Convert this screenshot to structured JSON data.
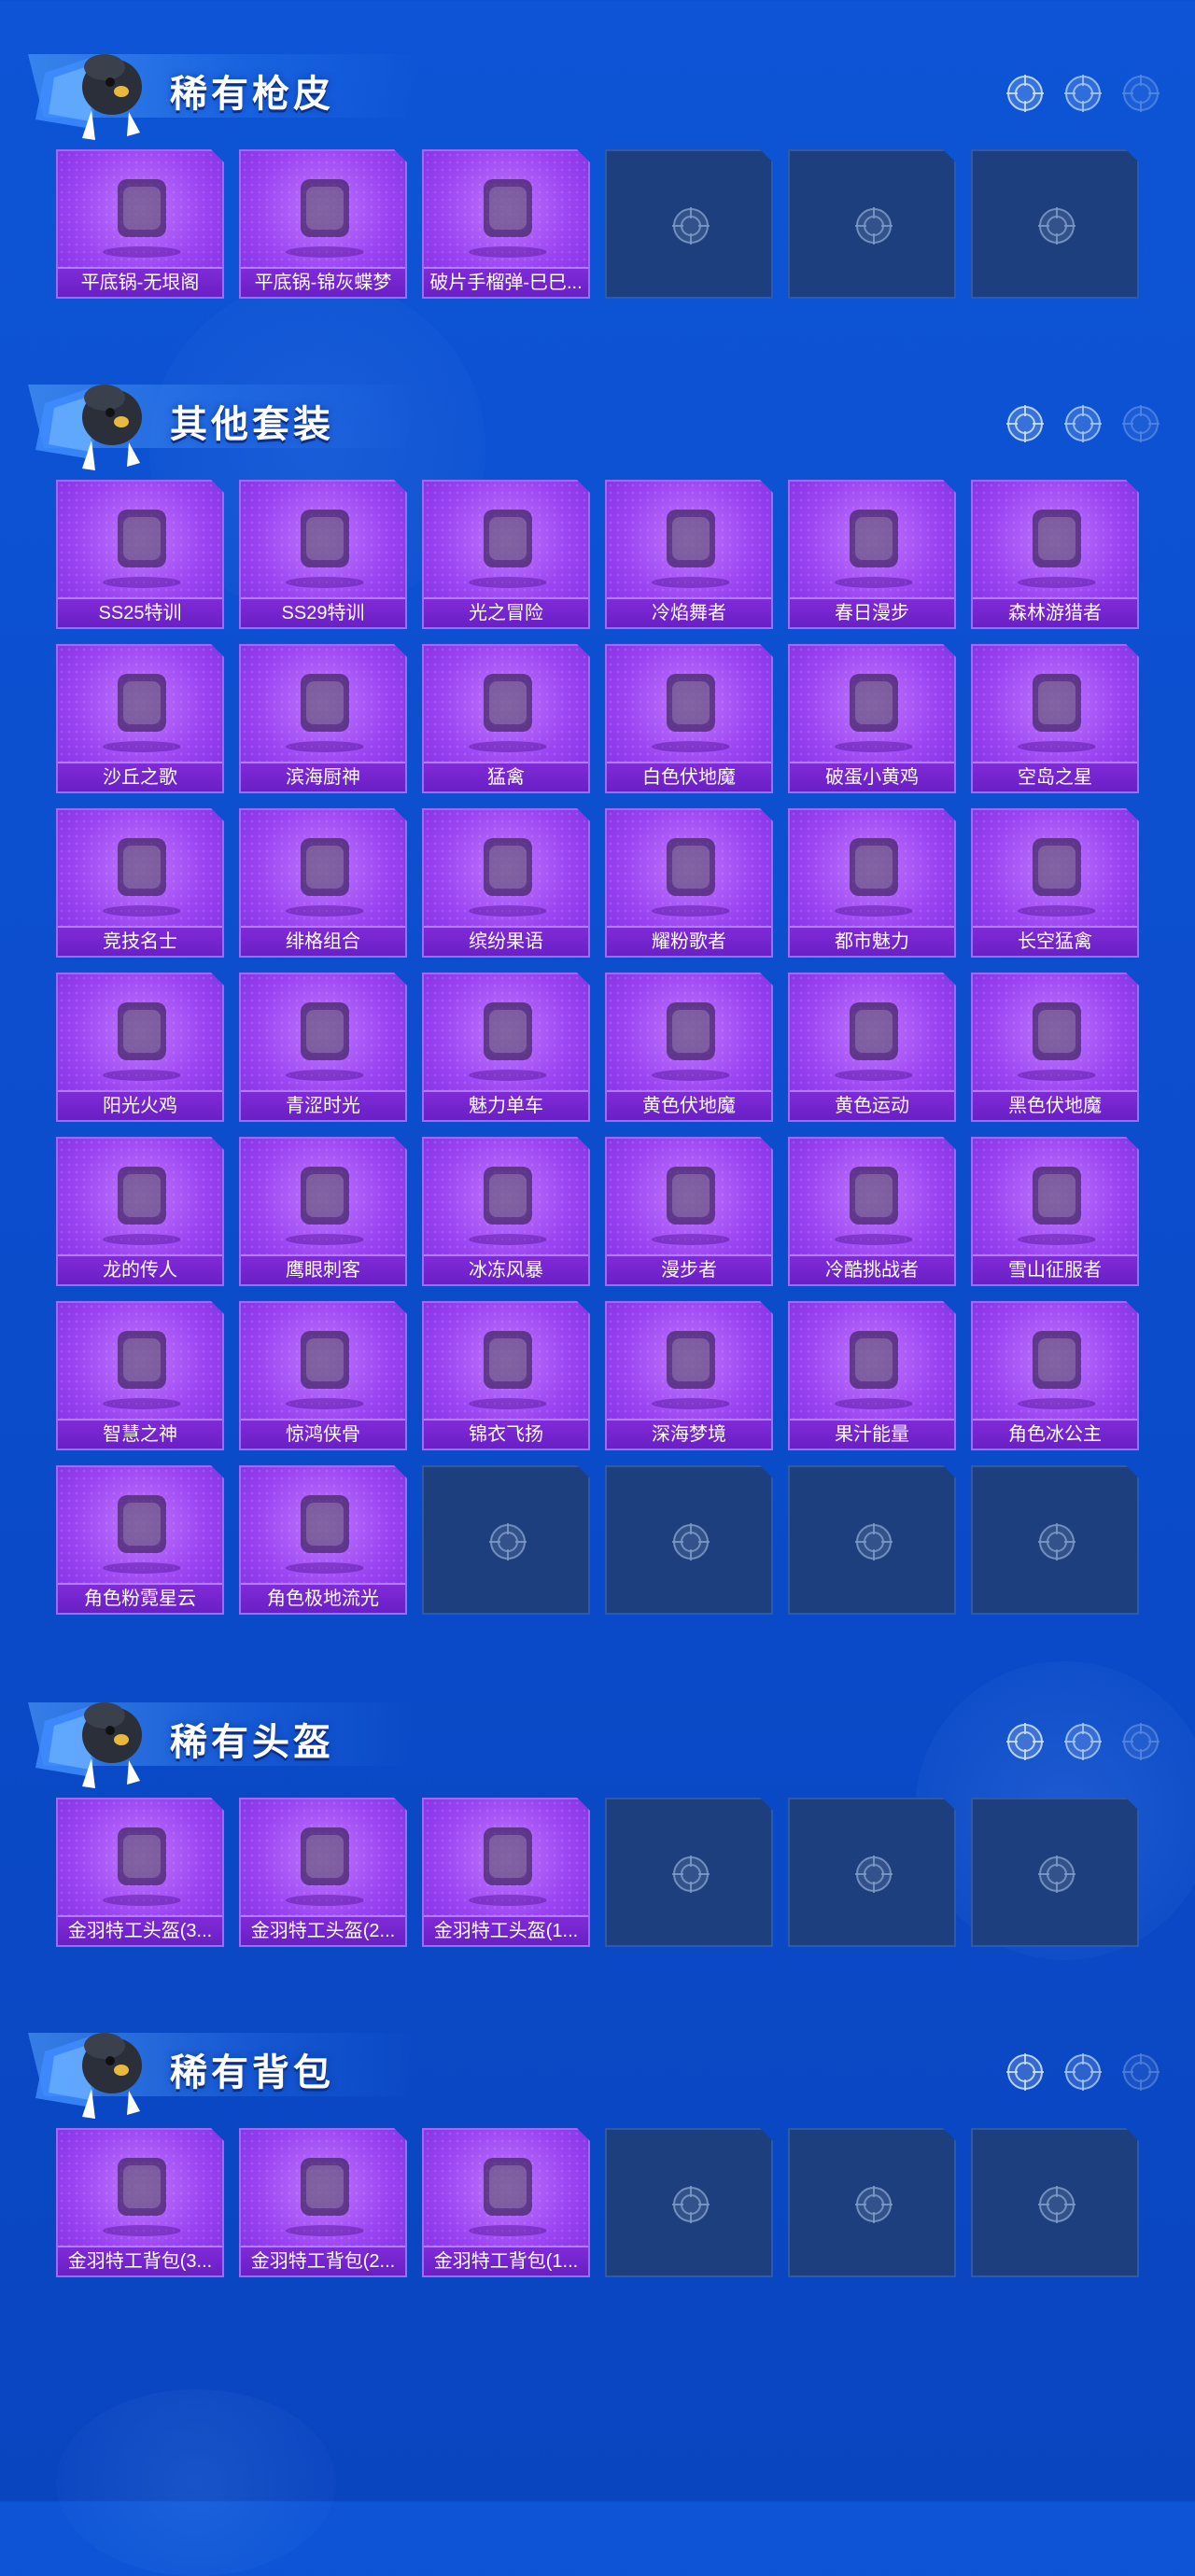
{
  "sections": [
    {
      "title": "稀有枪皮",
      "items": [
        "平底锅-无垠阁",
        "平底锅-锦灰蝶梦",
        "破片手榴弹-巳巳..."
      ],
      "empty_slots": 3
    },
    {
      "title": "其他套装",
      "items": [
        "SS25特训",
        "SS29特训",
        "光之冒险",
        "冷焰舞者",
        "春日漫步",
        "森林游猎者",
        "沙丘之歌",
        "滨海厨神",
        "猛禽",
        "白色伏地魔",
        "破蛋小黄鸡",
        "空岛之星",
        "竞技名士",
        "绯格组合",
        "缤纷果语",
        "耀粉歌者",
        "都市魅力",
        "长空猛禽",
        "阳光火鸡",
        "青涩时光",
        "魅力单车",
        "黄色伏地魔",
        "黄色运动",
        "黑色伏地魔",
        "龙的传人",
        "鹰眼刺客",
        "冰冻风暴",
        "漫步者",
        "冷酷挑战者",
        "雪山征服者",
        "智慧之神",
        "惊鸿侠骨",
        "锦衣飞扬",
        "深海梦境",
        "果汁能量",
        "角色冰公主",
        "角色粉霓星云",
        "角色极地流光"
      ],
      "empty_slots": 4
    },
    {
      "title": "稀有头盔",
      "items": [
        "金羽特工头盔(3...",
        "金羽特工头盔(2...",
        "金羽特工头盔(1..."
      ],
      "empty_slots": 3
    },
    {
      "title": "稀有背包",
      "items": [
        "金羽特工背包(3...",
        "金羽特工背包(2...",
        "金羽特工背包(1..."
      ],
      "empty_slots": 3
    }
  ],
  "colors": {
    "background": "#0c4fcf",
    "card_purple": "#9a43f2",
    "label_purple": "#6a1fc4",
    "empty_slot": "#1d3f7e"
  },
  "icons": {
    "section_mascot": "chicken-mascot-icon",
    "header_deco": "crosshair-icon",
    "empty_slot": "crosshair-icon"
  }
}
